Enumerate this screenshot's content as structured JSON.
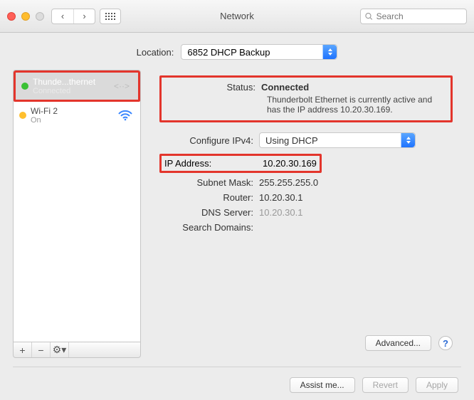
{
  "window": {
    "title": "Network"
  },
  "search": {
    "placeholder": "Search"
  },
  "location": {
    "label": "Location:",
    "value": "6852 DHCP Backup"
  },
  "sidebar": {
    "items": [
      {
        "name": "Thunde...thernet",
        "sub": "Connected",
        "status": "green",
        "icon": "ethernet"
      },
      {
        "name": "Wi-Fi 2",
        "sub": "On",
        "status": "amber",
        "icon": "wifi"
      }
    ]
  },
  "footer": {
    "add": "+",
    "remove": "−",
    "gear": "⚙︎▾"
  },
  "details": {
    "status_label": "Status:",
    "status_value": "Connected",
    "status_desc": "Thunderbolt Ethernet is currently active and has the IP address 10.20.30.169.",
    "configure_label": "Configure IPv4:",
    "configure_value": "Using DHCP",
    "ip_label": "IP Address:",
    "ip_value": "10.20.30.169",
    "subnet_label": "Subnet Mask:",
    "subnet_value": "255.255.255.0",
    "router_label": "Router:",
    "router_value": "10.20.30.1",
    "dns_label": "DNS Server:",
    "dns_value": "10.20.30.1",
    "search_label": "Search Domains:",
    "search_value": ""
  },
  "buttons": {
    "advanced": "Advanced...",
    "assist": "Assist me...",
    "revert": "Revert",
    "apply": "Apply"
  }
}
